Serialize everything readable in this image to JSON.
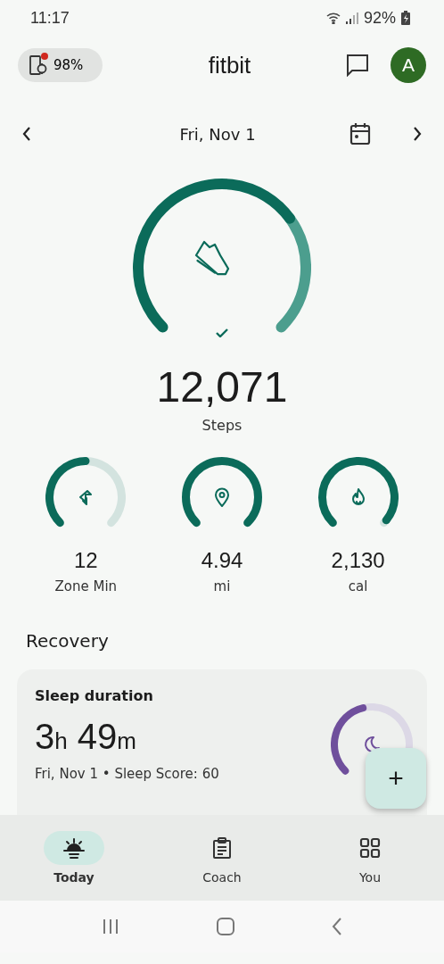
{
  "status_bar": {
    "time": "11:17",
    "battery": "92%"
  },
  "header": {
    "device_battery": "98%",
    "device_alert": true,
    "title": "fitbit",
    "avatar": "A"
  },
  "date_nav": {
    "date": "Fri, Nov 1"
  },
  "steps": {
    "goal_met": true,
    "value": "12,071",
    "label": "Steps"
  },
  "stats": [
    {
      "kind": "zone",
      "value": "12",
      "label": "Zone Min"
    },
    {
      "kind": "distance",
      "value": "4.94",
      "label": "mi"
    },
    {
      "kind": "calories",
      "value": "2,130",
      "label": "cal"
    }
  ],
  "recovery": {
    "title": "Recovery",
    "card": {
      "title": "Sleep duration",
      "hours": "3",
      "hours_unit": "h",
      "minutes": "49",
      "minutes_unit": "m",
      "detail": "Fri, Nov 1 • Sleep Score: 60"
    }
  },
  "fab": {
    "label": "+"
  },
  "bottom_nav": [
    {
      "kind": "today",
      "label": "Today",
      "selected": true
    },
    {
      "kind": "coach",
      "label": "Coach",
      "selected": false
    },
    {
      "kind": "you",
      "label": "You",
      "selected": false
    }
  ]
}
